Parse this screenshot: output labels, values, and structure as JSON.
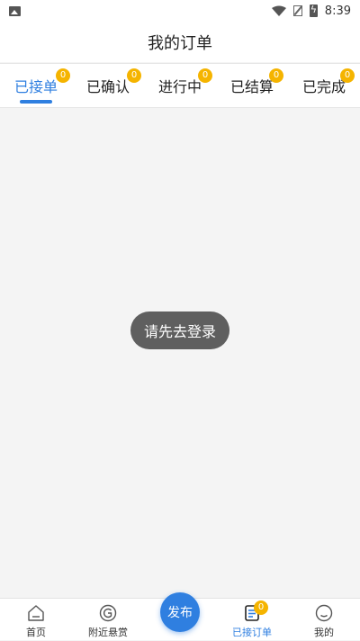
{
  "status_bar": {
    "time": "8:39"
  },
  "header": {
    "title": "我的订单"
  },
  "tabs": [
    {
      "label": "已接单",
      "badge": "0",
      "active": true
    },
    {
      "label": "已确认",
      "badge": "0",
      "active": false
    },
    {
      "label": "进行中",
      "badge": "0",
      "active": false
    },
    {
      "label": "已结算",
      "badge": "0",
      "active": false
    },
    {
      "label": "已完成",
      "badge": "0",
      "active": false
    }
  ],
  "toast": {
    "text": "请先去登录"
  },
  "bottom_nav": {
    "items": [
      {
        "label": "首页",
        "icon": "home-icon"
      },
      {
        "label": "附近悬赏",
        "icon": "nearby-icon"
      },
      {
        "label": "已接订单",
        "icon": "orders-icon",
        "badge": "0",
        "active": true
      },
      {
        "label": "我的",
        "icon": "profile-icon"
      }
    ],
    "publish_label": "发布"
  },
  "colors": {
    "accent": "#2f7fe0",
    "badge": "#f5b400"
  }
}
